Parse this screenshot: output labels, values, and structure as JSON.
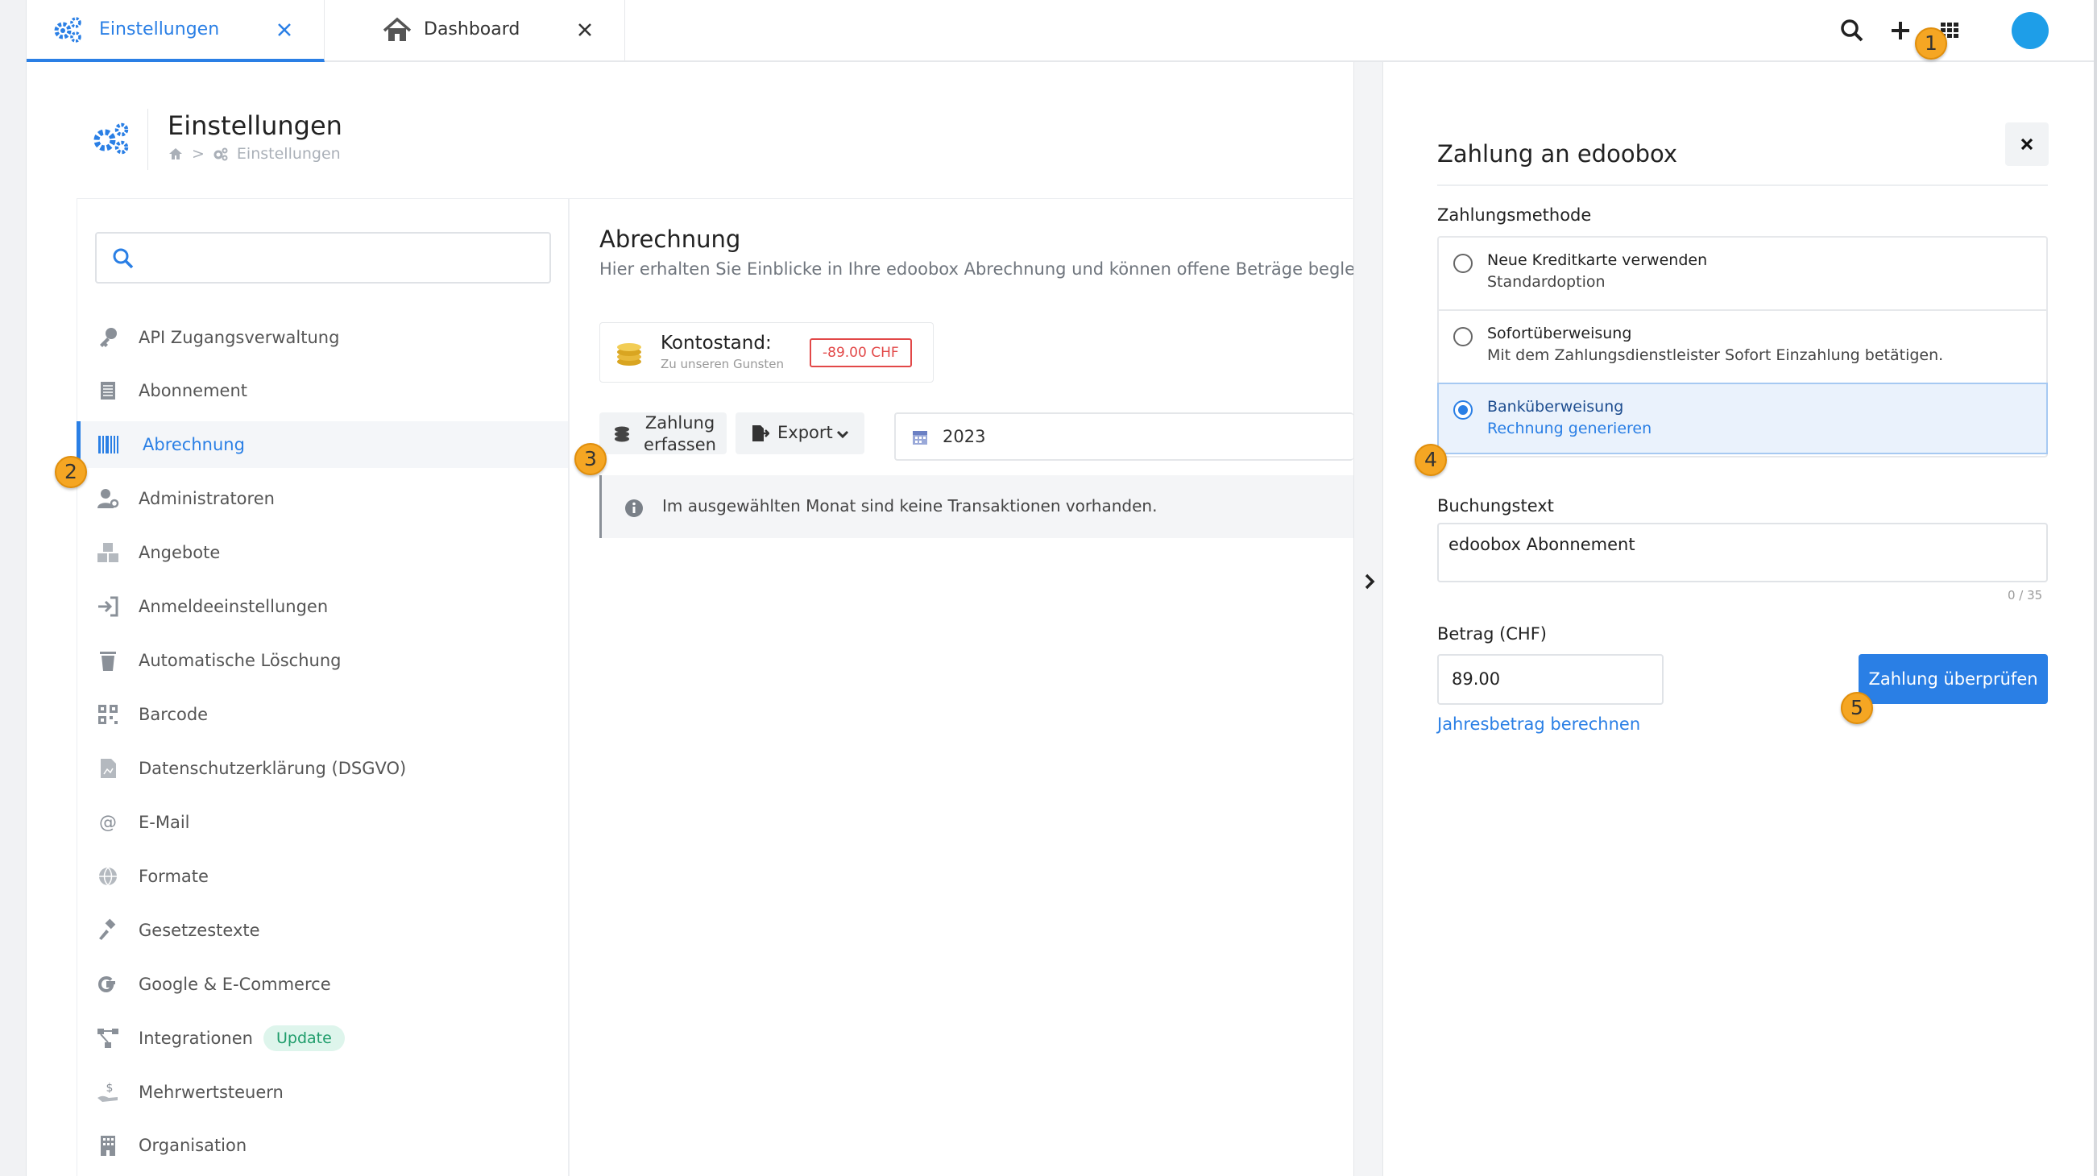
{
  "tabs": [
    {
      "label": "Einstellungen",
      "active": true,
      "icon": "gears-icon"
    },
    {
      "label": "Dashboard",
      "active": false,
      "icon": "home-icon"
    }
  ],
  "header": {
    "title": "Einstellungen",
    "breadcrumb": [
      "home-icon",
      "Einstellungen"
    ]
  },
  "sidebar": {
    "search_placeholder": "",
    "items": [
      {
        "label": "API Zugangsverwaltung",
        "icon": "key-icon"
      },
      {
        "label": "Abonnement",
        "icon": "list-icon"
      },
      {
        "label": "Abrechnung",
        "icon": "barcode-icon",
        "active": true
      },
      {
        "label": "Administratoren",
        "icon": "user-cog-icon"
      },
      {
        "label": "Angebote",
        "icon": "cubes-icon"
      },
      {
        "label": "Anmeldeeinstellungen",
        "icon": "sign-in-icon"
      },
      {
        "label": "Automatische Löschung",
        "icon": "trash-icon"
      },
      {
        "label": "Barcode",
        "icon": "qr-icon"
      },
      {
        "label": "Datenschutzerklärung (DSGVO)",
        "icon": "document-icon"
      },
      {
        "label": "E-Mail",
        "icon": "at-icon"
      },
      {
        "label": "Formate",
        "icon": "globe-icon"
      },
      {
        "label": "Gesetzestexte",
        "icon": "gavel-icon"
      },
      {
        "label": "Google & E-Commerce",
        "icon": "google-icon"
      },
      {
        "label": "Integrationen",
        "icon": "network-icon",
        "badge": "Update"
      },
      {
        "label": "Mehrwertsteuern",
        "icon": "hand-dollar-icon"
      },
      {
        "label": "Organisation",
        "icon": "building-icon"
      }
    ]
  },
  "main": {
    "title": "Abrechnung",
    "subtitle": "Hier erhalten Sie Einblicke in Ihre edoobox Abrechnung und können offene Beträge begleichen.",
    "balance": {
      "label": "Kontostand:",
      "sublabel": "Zu unseren Gunsten",
      "amount": "-89.00 CHF"
    },
    "zahlung_label_1": "Zahlung",
    "zahlung_label_2": "erfassen",
    "export_label": "Export",
    "year": "2023",
    "info_text": "Im ausgewählten Monat sind keine Transaktionen vorhanden."
  },
  "drawer": {
    "title": "Zahlung an edoobox",
    "method_label": "Zahlungsmethode",
    "methods": [
      {
        "title": "Neue Kreditkarte verwenden",
        "desc": "Standardoption",
        "selected": false
      },
      {
        "title": "Sofortüberweisung",
        "desc": "Mit dem Zahlungsdienstleister Sofort Einzahlung betätigen.",
        "selected": false
      },
      {
        "title": "Banküberweisung",
        "desc": "Rechnung generieren",
        "selected": true
      }
    ],
    "buchungstext_label": "Buchungstext",
    "buchungstext_value": "edoobox Abonnement",
    "counter": "0 / 35",
    "betrag_label": "Betrag (CHF)",
    "betrag_value": "89.00",
    "jahres_link": "Jahresbetrag berechnen",
    "submit_label": "Zahlung überprüfen"
  },
  "markers": [
    "1",
    "2",
    "3",
    "4",
    "5"
  ],
  "colors": {
    "accent": "#2a7fe5",
    "negative": "#e24848",
    "marker": "#f5a623",
    "avatar": "#1e9ee8"
  }
}
